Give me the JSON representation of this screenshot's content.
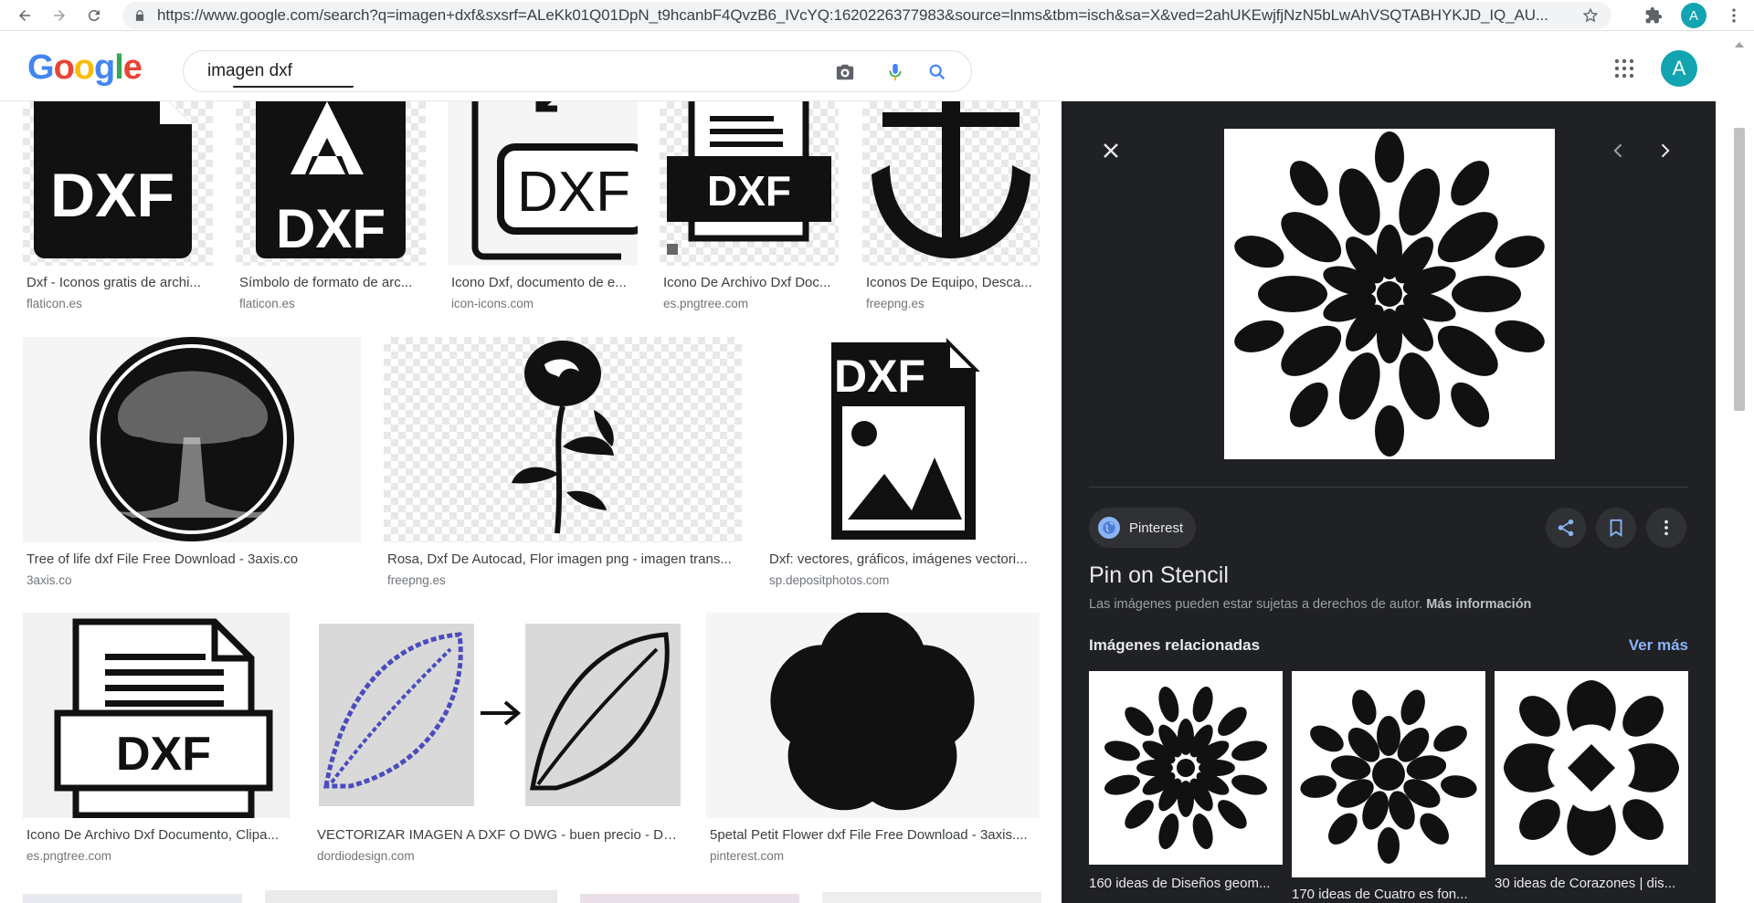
{
  "browser": {
    "url": "https://www.google.com/search?q=imagen+dxf&sxsrf=ALeKk01Q01DpN_t9hcanbF4QvzB6_IVcYQ:1620226377983&source=lnms&tbm=isch&sa=X&ved=2ahUKEwjfjNzN5bLwAhVSQTABHYKJD_IQ_AU...",
    "avatar_letter": "A"
  },
  "google": {
    "logo": [
      "G",
      "o",
      "o",
      "g",
      "l",
      "e"
    ],
    "query": "imagen dxf",
    "avatar_letter": "A"
  },
  "results": [
    {
      "title": "Dxf - Iconos gratis de archi...",
      "source": "flaticon.es"
    },
    {
      "title": "Símbolo de formato de arc...",
      "source": "flaticon.es"
    },
    {
      "title": "Icono Dxf, documento de e...",
      "source": "icon-icons.com"
    },
    {
      "title": "Icono De Archivo Dxf Doc...",
      "source": "es.pngtree.com"
    },
    {
      "title": "Iconos De Equipo, Desca...",
      "source": "freepng.es"
    },
    {
      "title": "Tree of life dxf File Free Download - 3axis.co",
      "source": "3axis.co"
    },
    {
      "title": "Rosa, Dxf De Autocad, Flor imagen png - imagen trans...",
      "source": "freepng.es"
    },
    {
      "title": "Dxf: vectores, gráficos, imágenes vectori...",
      "source": "sp.depositphotos.com"
    },
    {
      "title": "Icono De Archivo Dxf Documento, Clipa...",
      "source": "es.pngtree.com"
    },
    {
      "title": "VECTORIZAR IMAGEN A DXF O DWG - buen precio - Dór...",
      "source": "dordiodesign.com"
    },
    {
      "title": "5petal Petit Flower dxf File Free Download - 3axis....",
      "source": "pinterest.com"
    }
  ],
  "thumb_text": {
    "dxf": "DXF"
  },
  "panel": {
    "source_name": "Pinterest",
    "title": "Pin on Stencil",
    "copyright_text": "Las imágenes pueden estar sujetas a derechos de autor.",
    "copyright_link": "Más información",
    "related_heading": "Imágenes relacionadas",
    "see_more": "Ver más",
    "related": [
      {
        "caption": "160 ideas de Diseños geom..."
      },
      {
        "caption": "170 ideas de Cuatro es fon..."
      },
      {
        "caption": "30 ideas de Corazones | dis..."
      }
    ]
  }
}
